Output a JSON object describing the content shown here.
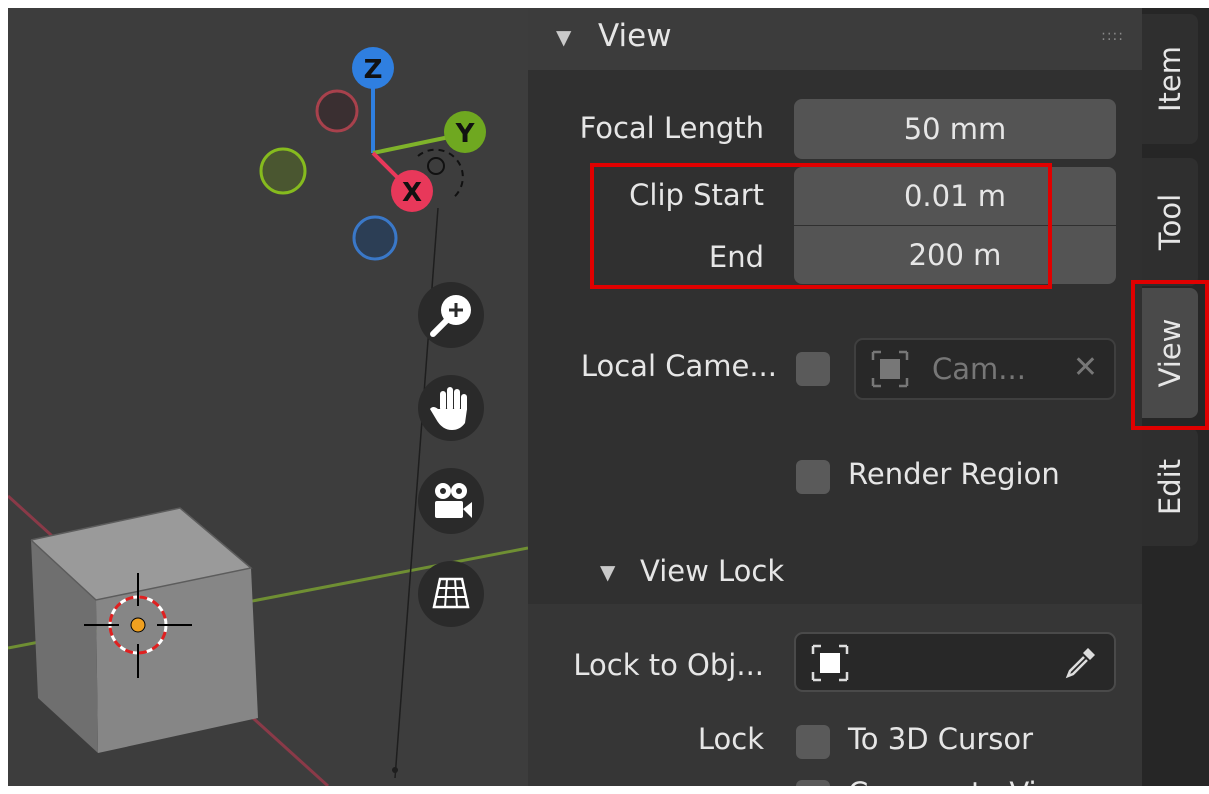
{
  "gizmo": {
    "z_label": "Z",
    "y_label": "Y",
    "x_label": "X"
  },
  "nav_buttons": [
    {
      "icon": "zoom-in-icon"
    },
    {
      "icon": "hand-pan-icon"
    },
    {
      "icon": "camera-view-icon"
    },
    {
      "icon": "ortho-grid-icon"
    }
  ],
  "panel": {
    "title": "View",
    "grip": "::::",
    "focal_length": {
      "label": "Focal Length",
      "value": "50 mm"
    },
    "clip_start": {
      "label": "Clip Start",
      "value": "0.01 m"
    },
    "clip_end": {
      "label": "End",
      "value": "200 m"
    },
    "local_camera": {
      "label": "Local Came...",
      "value": "Cam...",
      "clear": "✕"
    },
    "render_region": {
      "label": "Render Region"
    }
  },
  "view_lock": {
    "title": "View Lock",
    "lock_to_object": {
      "label": "Lock to Obj..."
    },
    "lock": {
      "label": "Lock",
      "cursor_label": "To 3D Cursor",
      "camera_label": "Camera to Vie"
    }
  },
  "tabs": [
    {
      "label": "Item"
    },
    {
      "label": "Tool"
    },
    {
      "label": "View",
      "active": true
    },
    {
      "label": "Edit"
    }
  ],
  "colors": {
    "x_axis": "#e8385a",
    "y_axis": "#7fb32a",
    "z_axis": "#2f7fe0",
    "highlight": "#e00000"
  }
}
